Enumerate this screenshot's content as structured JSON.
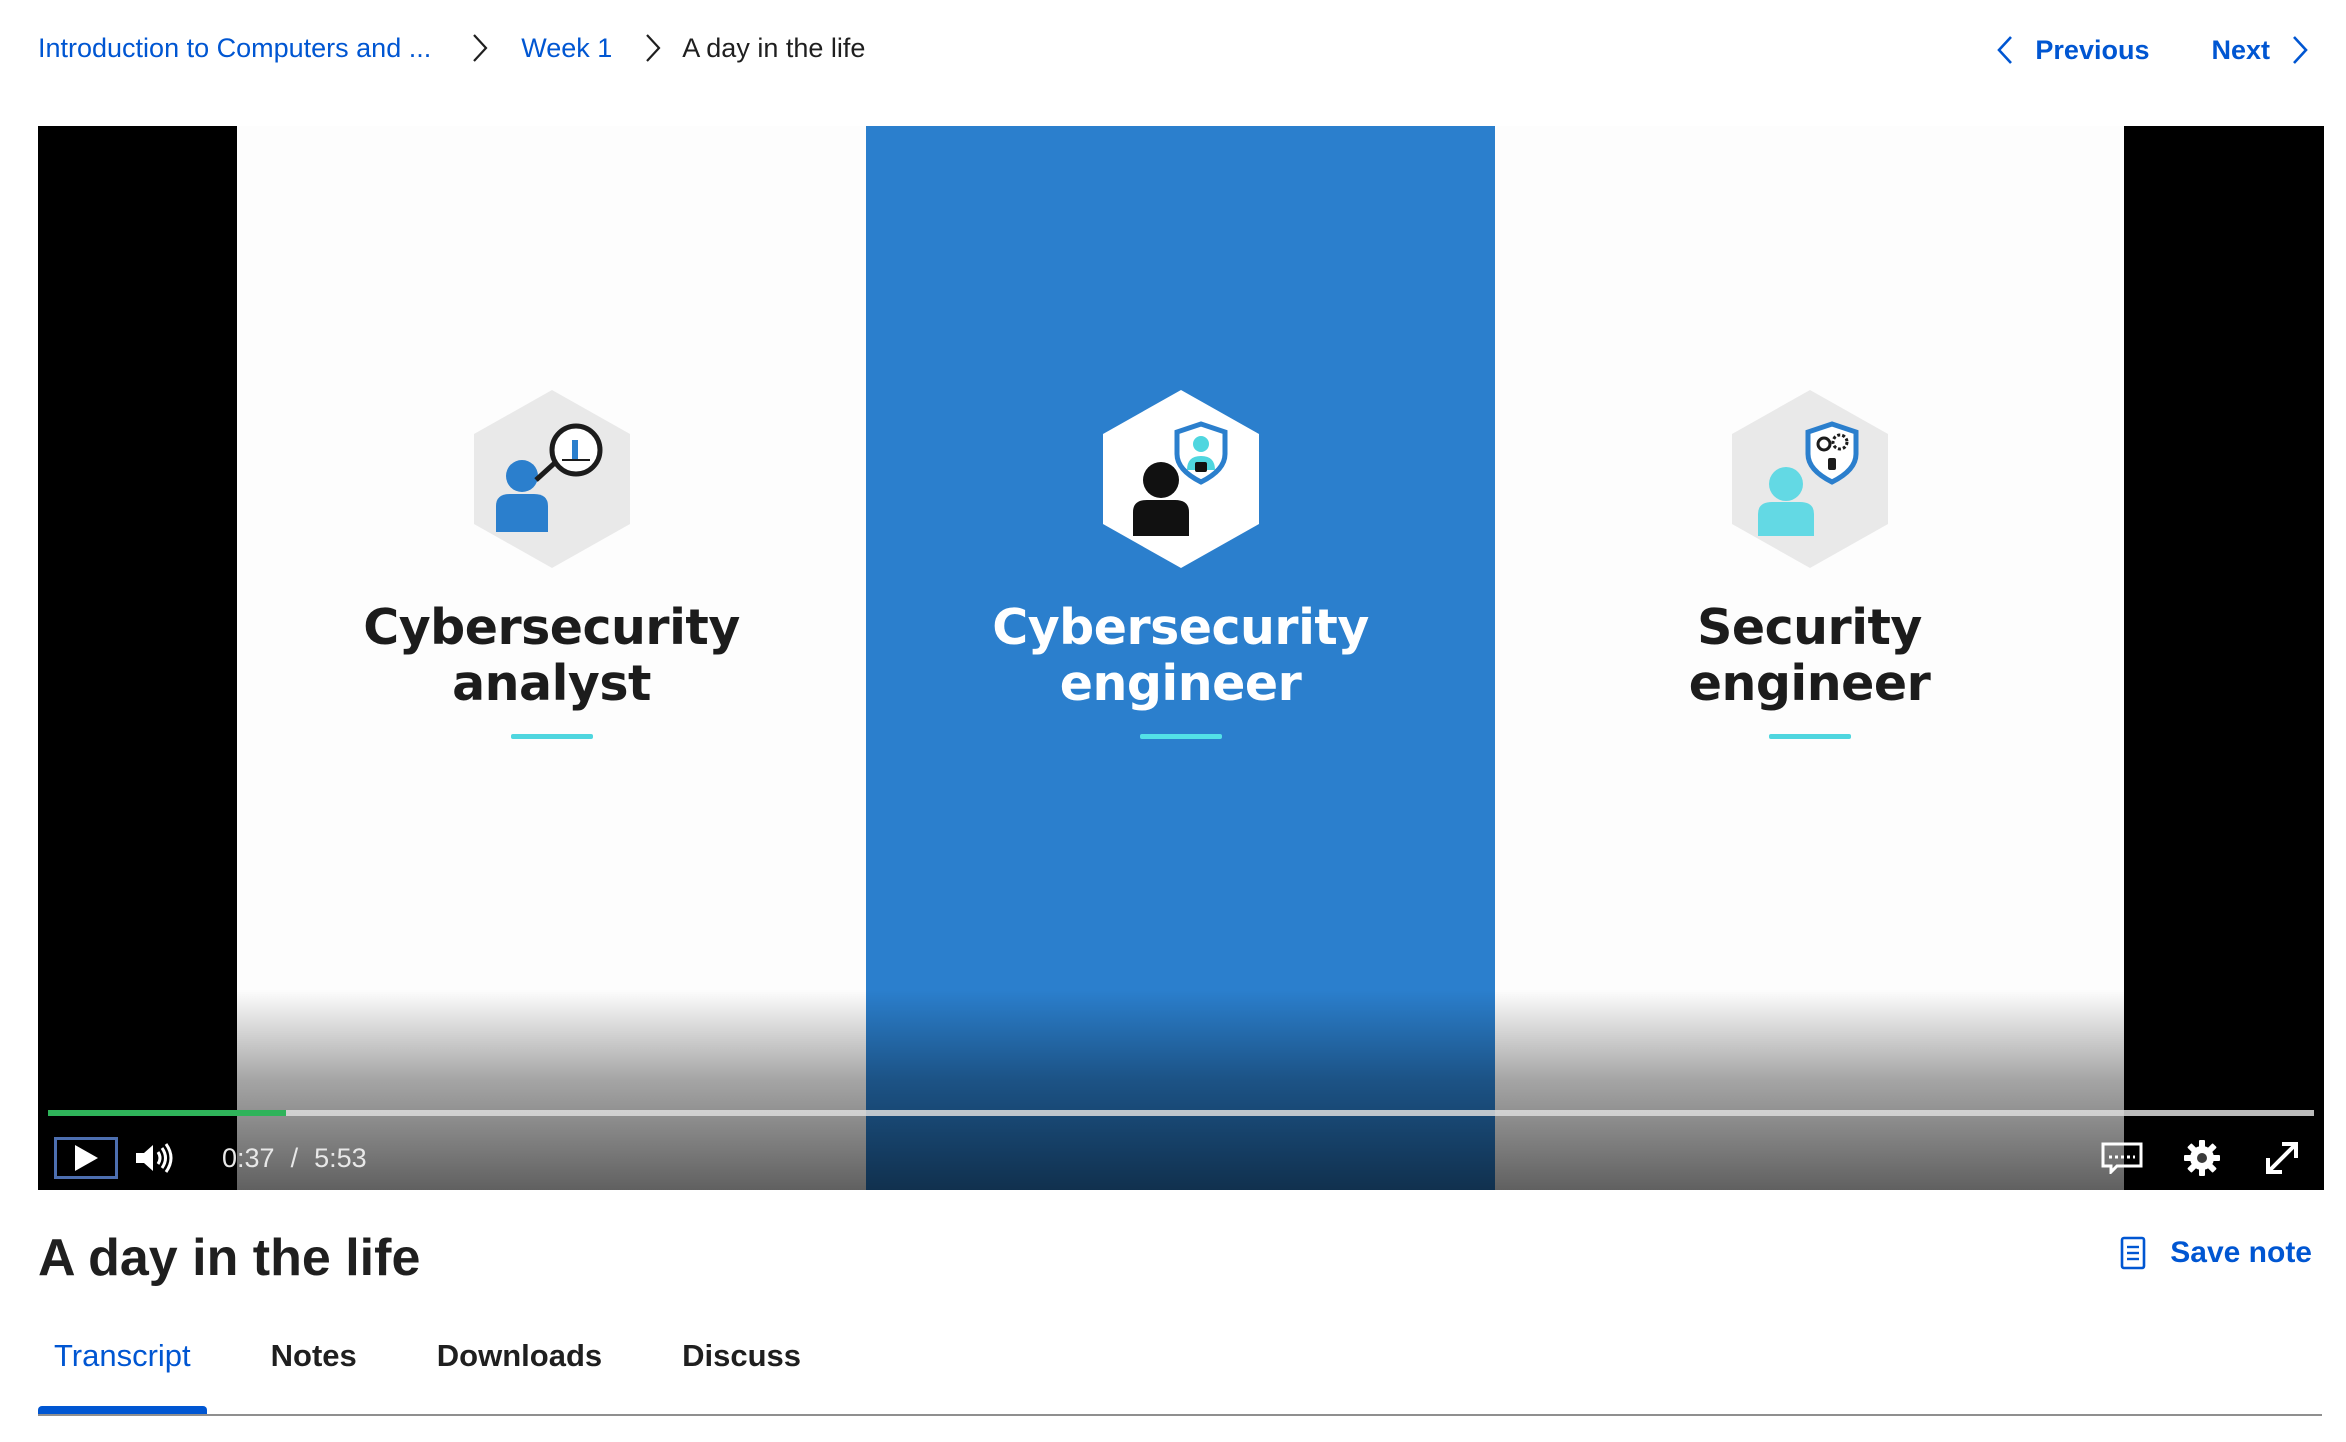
{
  "breadcrumb": {
    "course": "Introduction to Computers and ...",
    "week": "Week 1",
    "current": "A day in the life"
  },
  "nav": {
    "previous": "Previous",
    "next": "Next"
  },
  "video": {
    "roles": [
      {
        "title_line1": "Cybersecurity",
        "title_line2": "analyst",
        "icon": "analyst-magnifier-icon"
      },
      {
        "title_line1": "Cybersecurity",
        "title_line2": "engineer",
        "icon": "engineer-shield-icon"
      },
      {
        "title_line1": "Security",
        "title_line2": "engineer",
        "icon": "security-gear-shield-icon"
      }
    ],
    "current_time": "0:37",
    "separator": "/",
    "duration": "5:53",
    "progress_fraction": 0.105,
    "colors": {
      "progress": "#2fb35a",
      "blue_panel": "#2b7fcd",
      "accent_line": "#4fd6df"
    }
  },
  "title": "A day in the life",
  "save_note": "Save note",
  "tabs": [
    {
      "label": "Transcript",
      "active": true
    },
    {
      "label": "Notes",
      "active": false
    },
    {
      "label": "Downloads",
      "active": false
    },
    {
      "label": "Discuss",
      "active": false
    }
  ],
  "accent_color": "#0056d2"
}
